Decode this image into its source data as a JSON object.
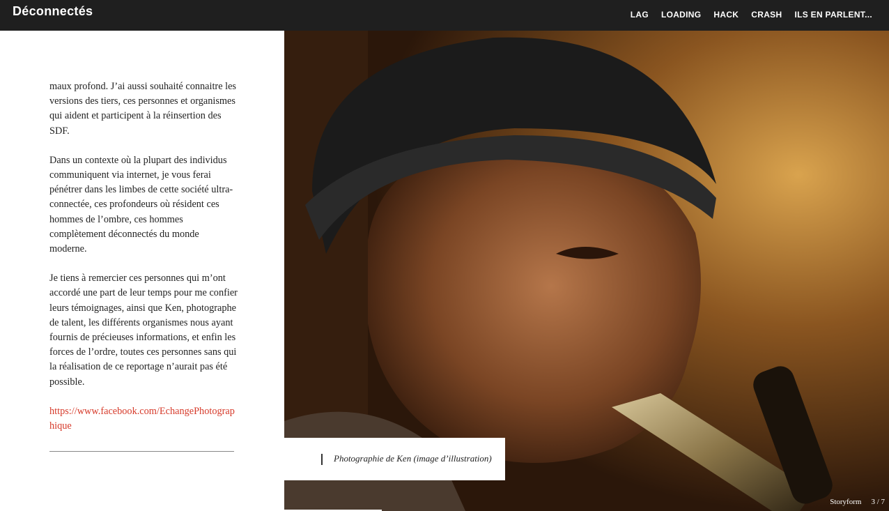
{
  "header": {
    "brand": "Déconnectés",
    "nav": [
      "LAG",
      "LOADING",
      "HACK",
      "CRASH",
      "ILS EN PARLENT..."
    ]
  },
  "article": {
    "paragraphs": [
      "maux profond. J’ai aussi souhaité connaitre les versions des tiers, ces personnes et organismes qui aident et participent  à la réinsertion des SDF.",
      "Dans un contexte où la plupart des individus communiquent via internet, je vous ferai pénétrer dans les limbes de cette société ultra-connectée, ces profondeurs où résident ces hommes de l’ombre, ces hommes complètement déconnectés du monde moderne.",
      "Je tiens à remercier ces personnes qui m’ont accordé une part de leur temps pour me confier leurs témoignages, ainsi que Ken, photographe de talent, les différents organismes nous ayant fournis de précieuses informations, et enfin les forces de l’ordre, toutes ces personnes sans qui la réalisation de ce reportage n’aurait pas été possible."
    ],
    "link": "https://www.facebook.com/EchangePhotographique"
  },
  "photo": {
    "caption": "Photographie de Ken (image d’illustration)"
  },
  "footer": {
    "brand": "Storyform",
    "page": "3 / 7"
  },
  "colors": {
    "topbar": "#1f1f1f",
    "link": "#d63a2a"
  }
}
